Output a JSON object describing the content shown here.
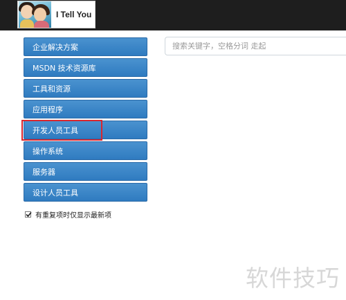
{
  "header": {
    "brand_text": "I Tell You"
  },
  "sidebar": {
    "items": [
      {
        "label": "企业解决方案"
      },
      {
        "label": "MSDN 技术资源库"
      },
      {
        "label": "工具和资源"
      },
      {
        "label": "应用程序"
      },
      {
        "label": "开发人员工具"
      },
      {
        "label": "操作系统"
      },
      {
        "label": "服务器"
      },
      {
        "label": "设计人员工具"
      }
    ]
  },
  "search": {
    "placeholder": "搜索关键字，空格分词 走起",
    "value": ""
  },
  "options": {
    "dedupe_label": "有重复项时仅显示最新项",
    "dedupe_checked": true
  },
  "watermark": {
    "text": "软件技巧"
  },
  "colors": {
    "topbar": "#1e1e1e",
    "menu_button": "#3a85c8",
    "highlight": "#d9262e"
  }
}
